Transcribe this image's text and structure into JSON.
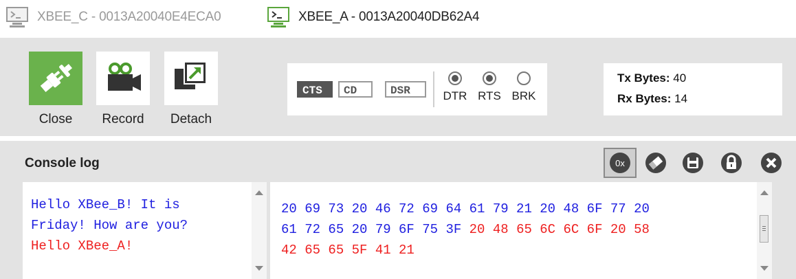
{
  "tabs": [
    {
      "label": "XBEE_C - 0013A20040E4ECA0",
      "active": false
    },
    {
      "label": "XBEE_A - 0013A20040DB62A4",
      "active": true
    }
  ],
  "toolbar": {
    "close_label": "Close",
    "record_label": "Record",
    "detach_label": "Detach"
  },
  "lines": {
    "cts": "CTS",
    "cd": "CD",
    "dsr": "DSR",
    "dtr": "DTR",
    "rts": "RTS",
    "brk": "BRK",
    "cts_active": true,
    "dtr_on": true,
    "rts_on": true,
    "brk_on": false
  },
  "stats": {
    "tx_label": "Tx Bytes:",
    "tx_value": "40",
    "rx_label": "Rx Bytes:",
    "rx_value": "14"
  },
  "console": {
    "title": "Console log",
    "hex_toggle_label": "0x",
    "ascii_lines": [
      {
        "text": "Hello XBee_B! It is",
        "color": "blue"
      },
      {
        "text": "Friday! How are you?",
        "color": "blue"
      },
      {
        "text": "Hello XBee_A!",
        "color": "red"
      }
    ],
    "hex_line1": "20 69 73 20 46 72 69 64 61 79 21 20 48 6F 77 20",
    "hex_line2_sent": "61 72 65 20 79 6F 75 3F ",
    "hex_line2_recv": "20 48 65 6C 6C 6F 20 58",
    "hex_line3": "42 65 65 5F 41 21"
  },
  "colors": {
    "sent": "#2020e0",
    "received": "#ee2020",
    "close_button": "#6ab24c",
    "panel_bg": "#e3e3e3"
  }
}
